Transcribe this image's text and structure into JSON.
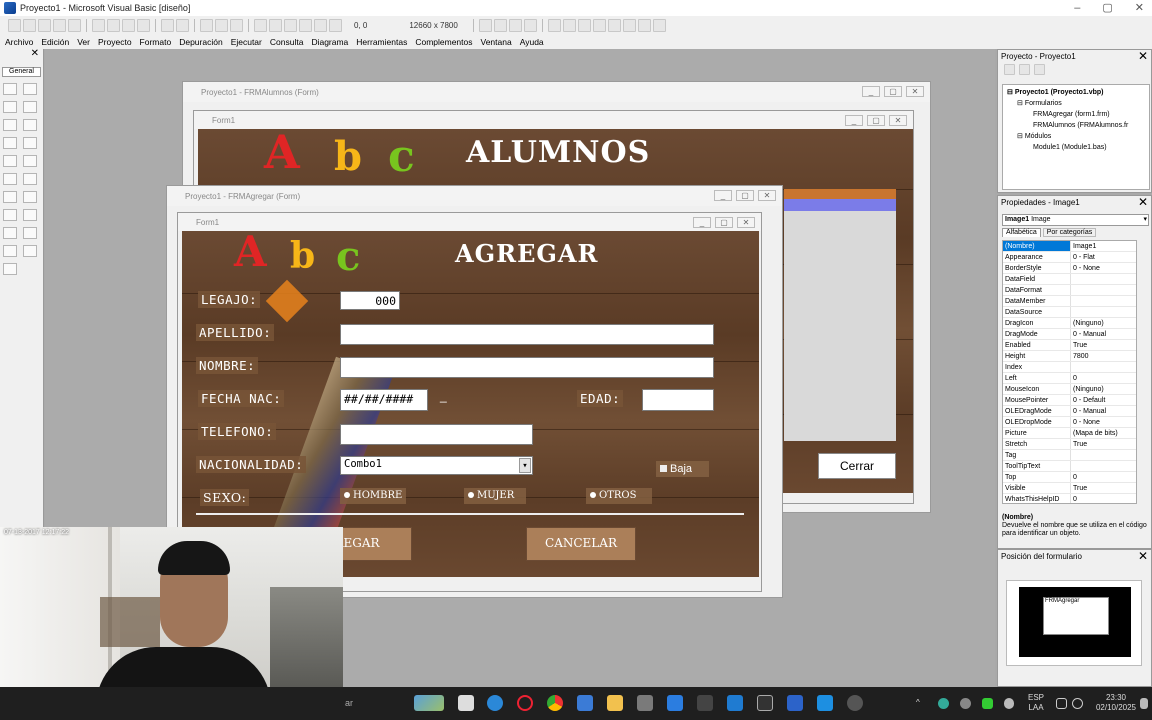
{
  "window": {
    "title": "Proyecto1 - Microsoft Visual Basic [diseño]",
    "controls": [
      "–",
      "▢",
      "✕"
    ]
  },
  "toolbar": {
    "position_readout": "0, 0",
    "size_readout": "12660 x 7800"
  },
  "menu": [
    "Archivo",
    "Edición",
    "Ver",
    "Proyecto",
    "Formato",
    "Depuración",
    "Ejecutar",
    "Consulta",
    "Diagrama",
    "Herramientas",
    "Complementos",
    "Ventana",
    "Ayuda"
  ],
  "toolbox": {
    "close": "✕",
    "tab": "General"
  },
  "back_window": {
    "title": "Proyecto1 - FRMAlumnos (Form)",
    "inner_title": "Form1",
    "heading": "ALUMNOS",
    "letters": [
      "A",
      "b",
      "c"
    ],
    "close_button": "Cerrar"
  },
  "front_window": {
    "title": "Proyecto1 - FRMAgregar (Form)",
    "inner_title": "Form1",
    "heading": "AGREGAR",
    "letters": [
      "A",
      "b",
      "c"
    ],
    "labels": {
      "legajo": "LEGAJO:",
      "apellido": "APELLIDO:",
      "nombre": "NOMBRE:",
      "fecha": "FECHA NAC:",
      "edad": "EDAD:",
      "telefono": "TELEFONO:",
      "nacionalidad": "NACIONALIDAD:",
      "sexo": "SEXO:"
    },
    "legajo_value": "000",
    "fecha_value": "##/##/####",
    "fecha_suffix": "_",
    "combo_value": "Combo1",
    "combo_arrow": "▾",
    "baja_label": "Baja",
    "options": [
      "HOMBRE",
      "MUJER",
      "OTROS"
    ],
    "agregar_button": "REGAR",
    "cancelar_button": "CANCELAR"
  },
  "project_panel": {
    "title": "Proyecto - Proyecto1",
    "root": "Proyecto1 (Proyecto1.vbp)",
    "forms_folder": "Formularios",
    "forms": [
      "FRMAgregar (form1.frm)",
      "FRMAlumnos (FRMAlumnos.fr"
    ],
    "modules_folder": "Módulos",
    "modules": [
      "Module1 (Module1.bas)"
    ]
  },
  "properties_panel": {
    "title": "Propiedades - Image1",
    "object": "Image1",
    "object_type": "Image",
    "tabs": [
      "Alfabética",
      "Por categorías"
    ],
    "rows": [
      [
        "(Nombre)",
        "Image1"
      ],
      [
        "Appearance",
        "0 - Flat"
      ],
      [
        "BorderStyle",
        "0 - None"
      ],
      [
        "DataField",
        ""
      ],
      [
        "DataFormat",
        ""
      ],
      [
        "DataMember",
        ""
      ],
      [
        "DataSource",
        ""
      ],
      [
        "DragIcon",
        "(Ninguno)"
      ],
      [
        "DragMode",
        "0 - Manual"
      ],
      [
        "Enabled",
        "True"
      ],
      [
        "Height",
        "7800"
      ],
      [
        "Index",
        ""
      ],
      [
        "Left",
        "0"
      ],
      [
        "MouseIcon",
        "(Ninguno)"
      ],
      [
        "MousePointer",
        "0 - Default"
      ],
      [
        "OLEDragMode",
        "0 - Manual"
      ],
      [
        "OLEDropMode",
        "0 - None"
      ],
      [
        "Picture",
        "(Mapa de bits)"
      ],
      [
        "Stretch",
        "True"
      ],
      [
        "Tag",
        ""
      ],
      [
        "ToolTipText",
        ""
      ],
      [
        "Top",
        "0"
      ],
      [
        "Visible",
        "True"
      ],
      [
        "WhatsThisHelpID",
        "0"
      ]
    ],
    "desc_title": "(Nombre)",
    "desc_text": "Devuelve el nombre que se utiliza en el código para identificar un objeto."
  },
  "layout_panel": {
    "title": "Posición del formulario",
    "form_label": "FRMAgregar"
  },
  "webcam": {
    "timestamp": "07-13-2017 12:17:22"
  },
  "taskbar": {
    "lang": "ESP",
    "lang2": "LAA",
    "time": "23:30",
    "date": "02/10/2025",
    "search_stub": "ar"
  }
}
